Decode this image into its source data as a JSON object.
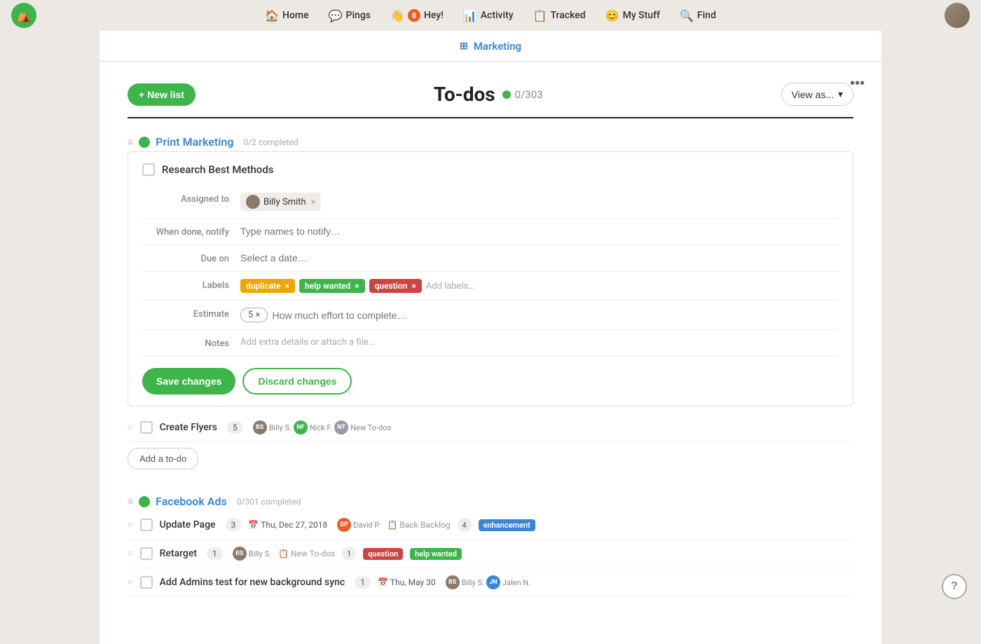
{
  "app": {
    "logo_alt": "Basecamp logo"
  },
  "nav": {
    "items": [
      {
        "id": "home",
        "label": "Home",
        "icon": "🏠",
        "badge": null
      },
      {
        "id": "pings",
        "label": "Pings",
        "icon": "💬",
        "badge": null
      },
      {
        "id": "hey",
        "label": "Hey!",
        "icon": "👋",
        "badge": "8"
      },
      {
        "id": "activity",
        "label": "Activity",
        "icon": "📊",
        "badge": null
      },
      {
        "id": "tracked",
        "label": "Tracked",
        "icon": "📋",
        "badge": null
      },
      {
        "id": "mystuff",
        "label": "My Stuff",
        "icon": "😊",
        "badge": null
      },
      {
        "id": "find",
        "label": "Find",
        "icon": "🔍",
        "badge": null
      }
    ]
  },
  "project": {
    "name": "Marketing"
  },
  "page": {
    "title": "To-dos",
    "count": "0/303",
    "options_label": "•••",
    "new_list_label": "+ New list",
    "view_as_label": "View as..."
  },
  "lists": [
    {
      "id": "print-marketing",
      "name": "Print Marketing",
      "completed": "0/2 completed",
      "todos": [
        {
          "id": "research-best",
          "title": "Research Best Methods",
          "expanded": true,
          "fields": {
            "assigned_to_label": "Assigned to",
            "assignee_name": "Billy Smith",
            "notify_label": "When done, notify",
            "notify_placeholder": "Type names to notify…",
            "due_label": "Due on",
            "due_placeholder": "Select a date…",
            "labels_label": "Labels",
            "labels": [
              {
                "text": "duplicate",
                "type": "duplicate"
              },
              {
                "text": "help wanted",
                "type": "help"
              },
              {
                "text": "question",
                "type": "question"
              }
            ],
            "add_labels_placeholder": "Add labels…",
            "estimate_label": "Estimate",
            "estimate_value": "5 ×",
            "estimate_placeholder": "How much effort to complete…",
            "notes_label": "Notes",
            "notes_placeholder": "Add extra details or attach a file…"
          },
          "save_label": "Save changes",
          "discard_label": "Discard changes"
        },
        {
          "id": "create-flyers",
          "title": "Create Flyers",
          "expanded": false,
          "estimate": "5",
          "assignees": [
            {
              "initials": "BS",
              "label": "Billy S.",
              "color": "brown"
            },
            {
              "initials": "NF",
              "label": "Nick F.",
              "color": "green"
            },
            {
              "initials": "NT",
              "label": "New To-dos",
              "color": "gray"
            }
          ]
        }
      ],
      "add_todo_label": "Add a to-do"
    },
    {
      "id": "facebook-ads",
      "name": "Facebook Ads",
      "completed": "0/301 completed",
      "todos": [
        {
          "id": "update-page",
          "title": "Update Page",
          "estimate": "3",
          "due": "Thu, Dec 27, 2018",
          "assignees": [
            {
              "initials": "DP",
              "label": "David P.",
              "color": "orange"
            }
          ],
          "location": "Back Backlog",
          "location_count": "4",
          "labels": [
            {
              "text": "enhancement",
              "type": "enhancement"
            }
          ]
        },
        {
          "id": "retarget",
          "title": "Retarget",
          "estimate": "1",
          "assignees": [
            {
              "initials": "BS",
              "label": "Billy S.",
              "color": "brown"
            }
          ],
          "location": "New To-dos",
          "location_count": "1",
          "labels": [
            {
              "text": "question",
              "type": "question"
            },
            {
              "text": "help wanted",
              "type": "help"
            }
          ]
        },
        {
          "id": "add-admins",
          "title": "Add Admins test for new background sync",
          "estimate": "1",
          "due": "Thu, May 30",
          "assignees": [
            {
              "initials": "BS",
              "label": "Billy S.",
              "color": "brown"
            },
            {
              "initials": "JN",
              "label": "Jalen N.",
              "color": "blue"
            }
          ]
        }
      ]
    }
  ],
  "help_button_label": "?"
}
